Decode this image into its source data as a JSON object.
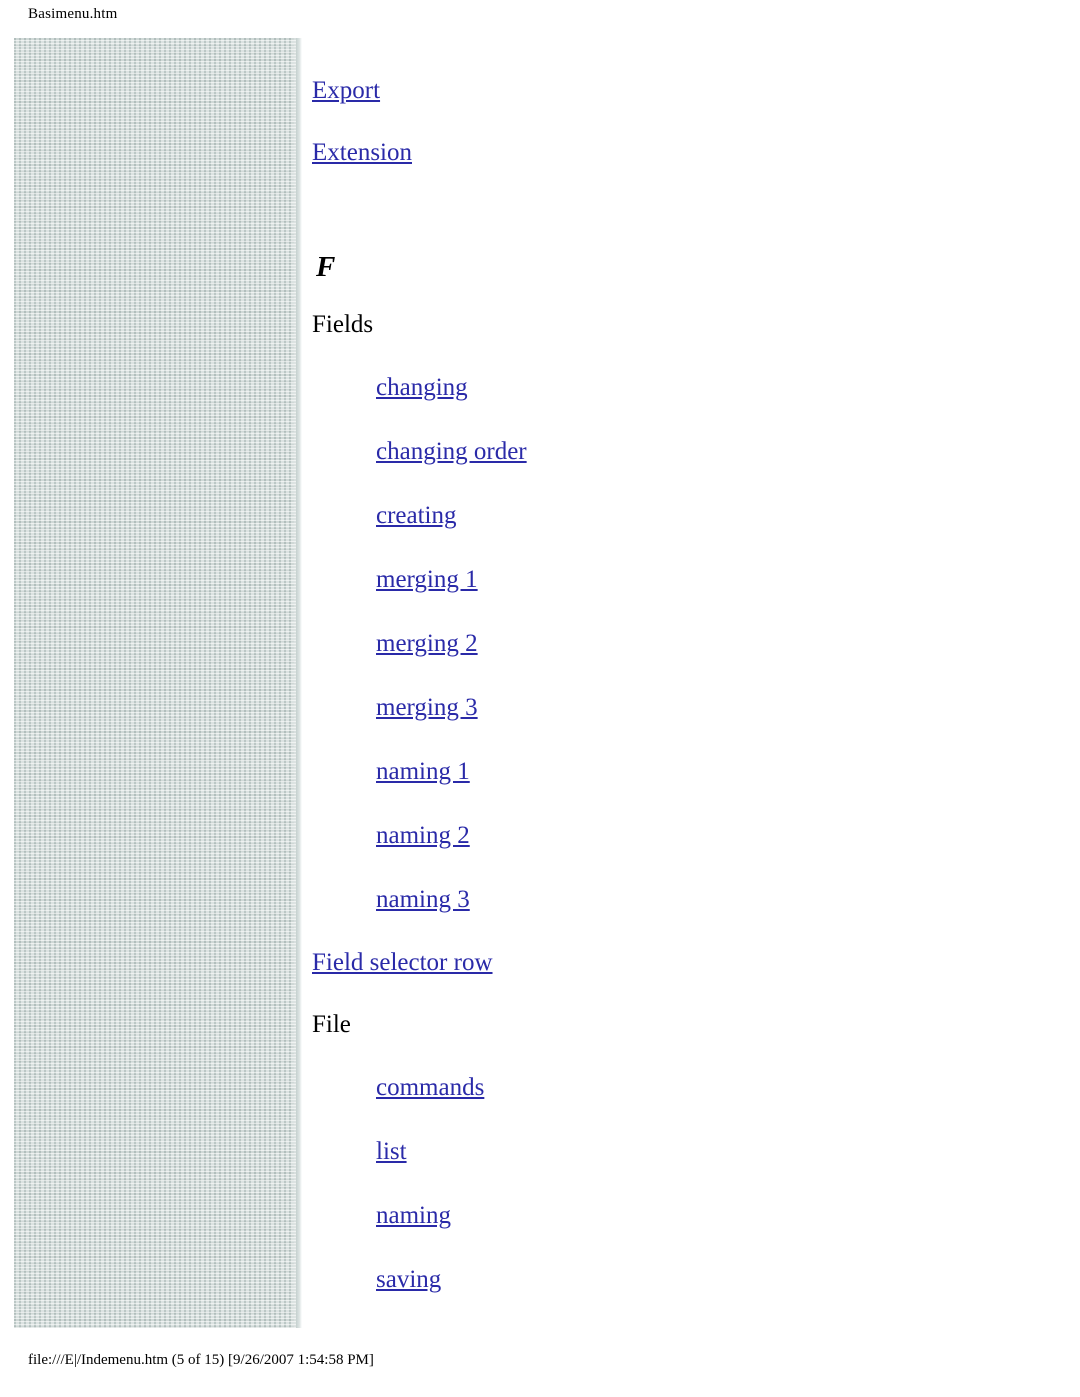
{
  "header": {
    "filename": "Basimenu.htm"
  },
  "footer": {
    "path_status": "file:///E|/Indemenu.htm (5 of 15) [9/26/2007 1:54:58 PM]"
  },
  "toc": {
    "top_links": [
      {
        "label": "Export",
        "level": 1
      },
      {
        "label": "Extension",
        "level": 1
      }
    ],
    "section_letter": "F",
    "groups": [
      {
        "title": "Fields",
        "items": [
          {
            "label": "changing"
          },
          {
            "label": "changing order"
          },
          {
            "label": "creating"
          },
          {
            "label": "merging 1"
          },
          {
            "label": "merging 2"
          },
          {
            "label": "merging 3"
          },
          {
            "label": "naming 1"
          },
          {
            "label": "naming 2"
          },
          {
            "label": "naming 3"
          }
        ]
      }
    ],
    "standalone_link": {
      "label": "Field selector row"
    },
    "groups2": [
      {
        "title": "File",
        "items": [
          {
            "label": "commands"
          },
          {
            "label": "list"
          },
          {
            "label": "naming"
          },
          {
            "label": "saving"
          }
        ]
      }
    ]
  }
}
